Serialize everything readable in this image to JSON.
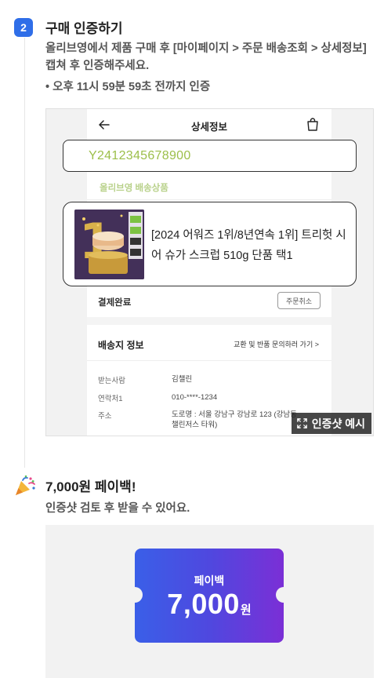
{
  "step": {
    "number": "2",
    "title": "구매 인증하기",
    "description": "올리브영에서 제품 구매 후 [마이페이지 > 주문 배송조회 > 상세정보] 캡쳐 후 인증해주세요.",
    "note": "• 오후 11시 59분 59초 전까지 인증"
  },
  "example_screenshot": {
    "header_title": "상세정보",
    "order_number": "Y2412345678900",
    "shipping_label": "올리브영 배송상품",
    "product_name": "[2024 어워즈 1위/8년연속 1위] 트리헛 시어 슈가 스크럽 510g 단품 택1",
    "payment_status": "결제완료",
    "cancel_button": "주문취소",
    "address_section_title": "배송지 정보",
    "exchange_link": "교환 및 반품 문의하러 가기 >",
    "rows": [
      {
        "label": "받는사람",
        "value": "김챌린"
      },
      {
        "label": "연락처1",
        "value": "010-****-1234"
      },
      {
        "label": "주소",
        "value": "도로명 : 서울 강남구 강남로 123 (강남동\n챌린저스 타워)"
      }
    ],
    "example_tag": "인증샷 예시"
  },
  "payback": {
    "title": "7,000원 페이백!",
    "description": "인증샷 검토 후 받을 수 있어요.",
    "ticket_label": "페이백",
    "ticket_amount": "7,000",
    "ticket_unit": "원"
  },
  "colors": {
    "accent_blue": "#2f6ee8",
    "order_green": "#9cbf4a",
    "ticket_gradient_start": "#3a5fe8",
    "ticket_gradient_end": "#7b2fd6"
  },
  "icons": [
    "back-arrow-icon",
    "shopping-bag-icon",
    "expand-icon",
    "party-popper-icon"
  ]
}
